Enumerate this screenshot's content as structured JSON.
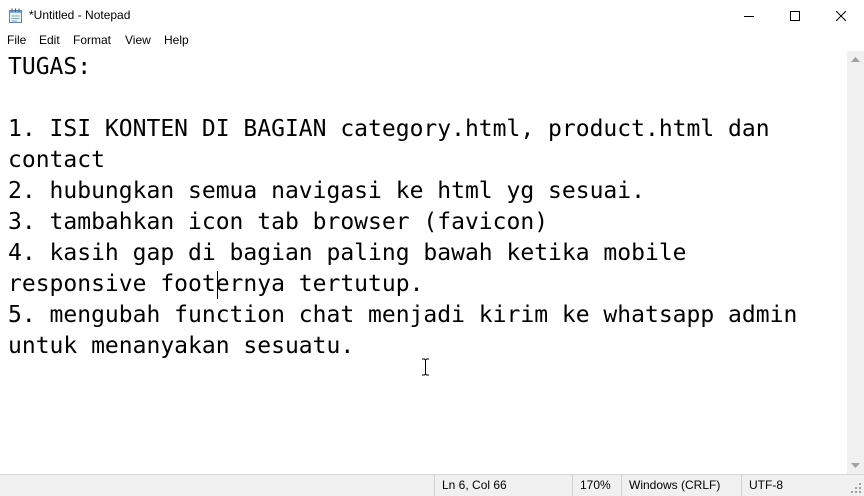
{
  "window": {
    "title": "*Untitled - Notepad",
    "minimize_glyph": "—",
    "maximize_glyph": "☐",
    "close_glyph": "✕"
  },
  "menu": {
    "items": [
      "File",
      "Edit",
      "Format",
      "View",
      "Help"
    ]
  },
  "document": {
    "lines": [
      "TUGAS:",
      "",
      "1. ISI KONTEN DI BAGIAN category.html, product.html dan",
      "contact",
      "2. hubungkan semua navigasi ke html yg sesuai.",
      "3. tambahkan icon tab browser (favicon)",
      "4. kasih gap di bagian paling bawah ketika mobile",
      "responsive footernya tertutup.",
      "5. mengubah function chat menjadi kirim ke whatsapp admin",
      "untuk menanyakan sesuatu."
    ]
  },
  "status": {
    "position": "Ln 6, Col 66",
    "zoom": "170%",
    "line_ending": "Windows (CRLF)",
    "encoding": "UTF-8"
  },
  "icons": {
    "app": "notepad-icon",
    "cursor": "text-cursor-icon"
  }
}
